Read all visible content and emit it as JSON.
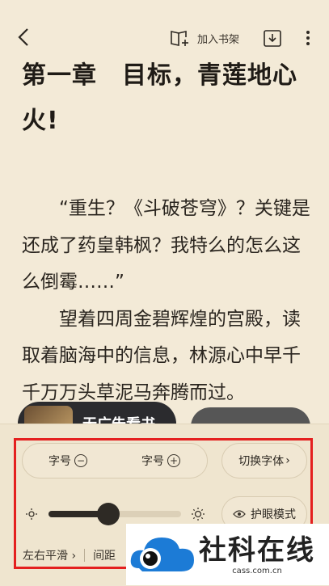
{
  "header": {
    "add_shelf_label": "加入书架"
  },
  "chapter": {
    "title": "第一章　目标，青莲地心火!"
  },
  "content": {
    "paragraphs": [
      "“重生？《斗破苍穹》？关键是还成了药皇韩枫？我特么的怎么这么倒霉……”",
      "望着四周金碧辉煌的宫殿，读取着脑海中的信息，林源心中早千千万万头草泥马奔腾而过。"
    ]
  },
  "promo": {
    "label": "无广告看书"
  },
  "settings": {
    "font_decrease_label": "字号",
    "font_increase_label": "字号",
    "switch_font_label": "切换字体",
    "eye_mode_label": "护眼模式",
    "brightness": 0.45,
    "page_turn_label": "左右平滑",
    "spacing_label": "间距"
  },
  "watermark": {
    "title": "社科在线",
    "url": "cass.com.cn"
  },
  "colors": {
    "background": "#f3ead7",
    "panel": "#efe5cf",
    "highlight_frame": "#e4201f",
    "watermark_blue": "#1c7bd6"
  }
}
